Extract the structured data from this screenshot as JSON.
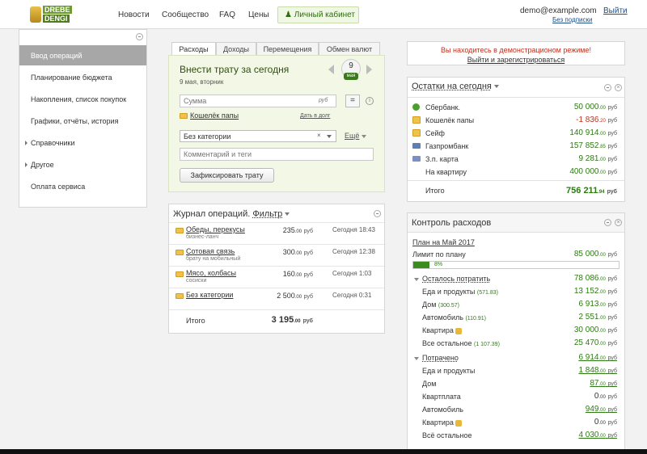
{
  "header": {
    "logo": {
      "line1": "DREBE",
      "line2": "DENGI"
    },
    "nav": [
      "Новости",
      "Сообщество",
      "FAQ",
      "Цены"
    ],
    "cabinet_button": "Личный кабинет",
    "user_email": "demo@example.com",
    "logout": "Выйти",
    "subscriptions": "Без подписки"
  },
  "sidebar": {
    "items": [
      {
        "label": "Ввод операций"
      },
      {
        "label": "Планирование бюджета"
      },
      {
        "label": "Накопления, список покупок"
      },
      {
        "label": "Графики, отчёты, история"
      },
      {
        "label": "Справочники"
      },
      {
        "label": "Другое"
      },
      {
        "label": "Оплата сервиса"
      }
    ]
  },
  "tabs": [
    "Расходы",
    "Доходы",
    "Перемещения",
    "Обмен валют"
  ],
  "expense_form": {
    "title": "Внести трату за сегодня",
    "date": "9 мая, вторник",
    "badge_day": "9",
    "badge_month": "мая",
    "amount_placeholder": "Сумма",
    "currency": "руб",
    "eq_button": "=",
    "info": "i",
    "wallet": "Кошелёк папы",
    "debt_link": "Дать в долг",
    "category": "Без категории",
    "clear": "×",
    "more": "Ещё",
    "comment_placeholder": "Комментарий и теги",
    "submit": "Зафиксировать трату"
  },
  "journal": {
    "title": "Журнал операций.",
    "filter": "Фильтр",
    "rows": [
      {
        "name": "Обеды, перекусы",
        "sub": "бизнес-ланч",
        "amount": "235",
        "cents": ".00",
        "cur": "руб",
        "when": "Сегодня 18:43"
      },
      {
        "name": "Сотовая связь",
        "sub": "брату на мобильный",
        "amount": "300",
        "cents": ".00",
        "cur": "руб",
        "when": "Сегодня 12:38"
      },
      {
        "name": "Мясо, колбасы",
        "sub": "сосиски",
        "amount": "160",
        "cents": ".00",
        "cur": "руб",
        "when": "Сегодня 1:03"
      },
      {
        "name": "Без категории",
        "sub": "",
        "amount": "2 500",
        "cents": ".00",
        "cur": "руб",
        "when": "Сегодня 0:31"
      }
    ],
    "total_label": "Итого",
    "total_amount": "3 195",
    "total_cents": ".00",
    "total_cur": "руб"
  },
  "demo": {
    "line1": "Вы находитесь в демонстрационом режиме!",
    "line2": "Выйти и зарегистрироваться"
  },
  "balances": {
    "title": "Остатки на сегодня",
    "rows": [
      {
        "name": "Сбербанк.",
        "amount": "50 000",
        "cents": ".00",
        "cur": "руб",
        "icon": "green-ball-icon",
        "negative": false
      },
      {
        "name": "Кошелёк папы",
        "amount": "-1 836",
        "cents": ".20",
        "cur": "руб",
        "icon": "folder-icon",
        "negative": true
      },
      {
        "name": "Сейф",
        "amount": "140 914",
        "cents": ".00",
        "cur": "руб",
        "icon": "folder-icon",
        "negative": false
      },
      {
        "name": "Газпромбанк",
        "amount": "157 852",
        "cents": ".85",
        "cur": "руб",
        "icon": "card-icon",
        "negative": false
      },
      {
        "name": "З.п. карта",
        "amount": "9 281",
        "cents": ".00",
        "cur": "руб",
        "icon": "card-icon",
        "negative": false
      },
      {
        "name": "На квартиру",
        "amount": "400 000",
        "cents": ".00",
        "cur": "руб",
        "icon": "none",
        "negative": false
      }
    ],
    "total_label": "Итого",
    "total_amount": "756 211",
    "total_cents": ".94",
    "total_cur": "руб"
  },
  "control": {
    "title": "Контроль расходов",
    "plan": "План на Май 2017",
    "limit_label": "Лимит по плану",
    "limit_amount": "85 000",
    "limit_cents": ".00",
    "limit_cur": "руб",
    "progress_percent": 8,
    "progress_label": "8%",
    "remaining": {
      "label": "Осталось потратить",
      "amount": "78 086",
      "cents": ".00",
      "cur": "руб",
      "rows": [
        {
          "name": "Еда и продукты",
          "extra": "(571.83)",
          "amount": "13 152",
          "cents": ".00",
          "cur": "руб",
          "coin": false
        },
        {
          "name": "Дом",
          "extra": "(300.57)",
          "amount": "6 913",
          "cents": ".00",
          "cur": "руб",
          "coin": false
        },
        {
          "name": "Автомобиль",
          "extra": "(110.91)",
          "amount": "2 551",
          "cents": ".00",
          "cur": "руб",
          "coin": false
        },
        {
          "name": "Квартира",
          "extra": "",
          "amount": "30 000",
          "cents": ".00",
          "cur": "руб",
          "coin": true
        },
        {
          "name": "Все остальное",
          "extra": "(1 107.39)",
          "amount": "25 470",
          "cents": ".00",
          "cur": "руб",
          "coin": false
        }
      ]
    },
    "spent": {
      "label": "Потрачено",
      "amount": "6 914",
      "cents": ".00",
      "cur": "руб",
      "rows": [
        {
          "name": "Еда и продукты",
          "amount": "1 848",
          "cents": ".00",
          "cur": "руб",
          "coin": false,
          "link": true
        },
        {
          "name": "Дом",
          "amount": "87",
          "cents": ".00",
          "cur": "руб",
          "coin": false,
          "link": true
        },
        {
          "name": "Квартплата",
          "amount": "0",
          "cents": ".00",
          "cur": "руб",
          "coin": false,
          "link": false
        },
        {
          "name": "Автомобиль",
          "amount": "949",
          "cents": ".00",
          "cur": "руб",
          "coin": false,
          "link": true
        },
        {
          "name": "Квартира",
          "amount": "0",
          "cents": ".00",
          "cur": "руб",
          "coin": true,
          "link": false
        },
        {
          "name": "Всё остальное",
          "amount": "4 030",
          "cents": ".00",
          "cur": "руб",
          "coin": false,
          "link": true
        }
      ]
    }
  },
  "colors": {
    "accent_green": "#2d7a12",
    "negative_red": "#c0311d",
    "link_blue": "#1b4f8c"
  }
}
